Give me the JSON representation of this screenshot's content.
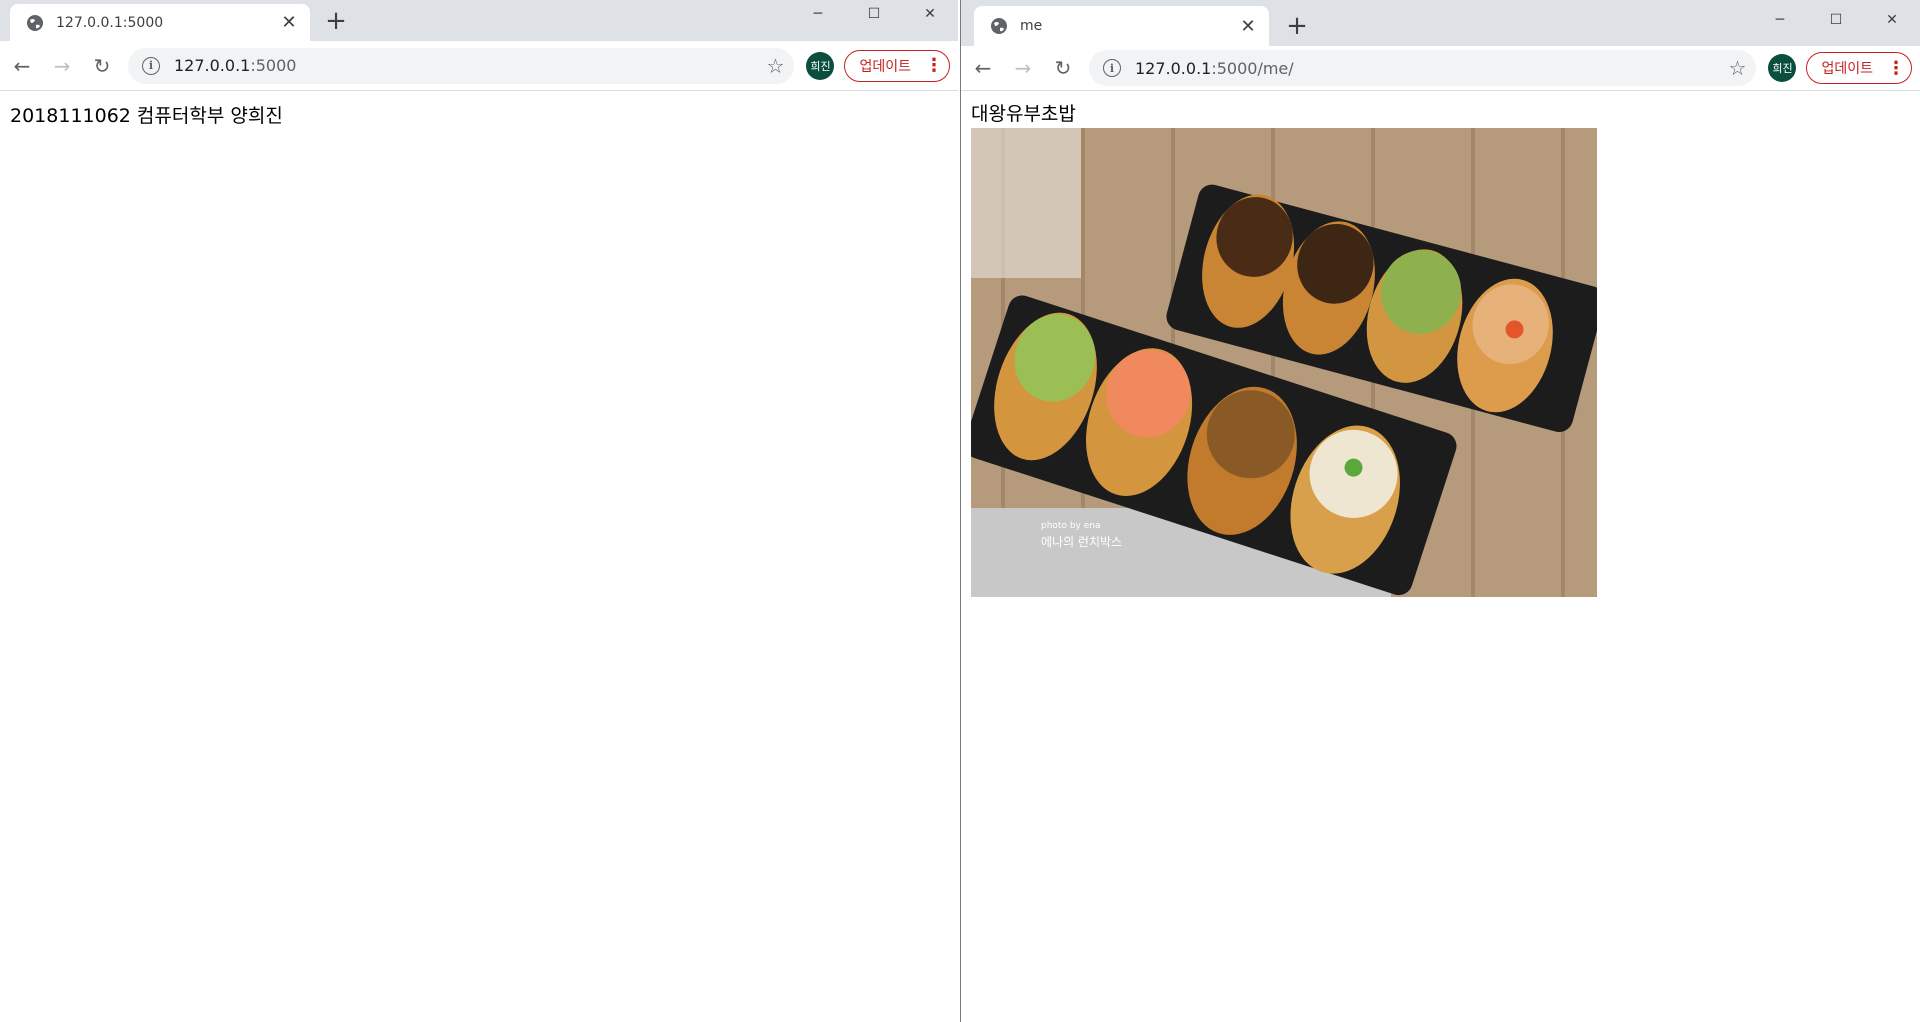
{
  "left_window": {
    "tab_title": "127.0.0.1:5000",
    "url_host": "127.0.0.1",
    "url_path": ":5000",
    "profile_initials": "희진",
    "update_label": "업데이트",
    "body_text": "2018111062 컴퓨터학부 양희진"
  },
  "right_window": {
    "tab_title": "me",
    "url_host": "127.0.0.1",
    "url_path": ":5000/me/",
    "profile_initials": "희진",
    "update_label": "업데이트",
    "heading": "대왕유부초밥",
    "image_watermark_small": "photo by ena",
    "image_watermark": "에나의 런치박스"
  },
  "icons": {
    "favicon": "globe-icon",
    "close": "close-icon",
    "new_tab": "plus-icon",
    "back": "back-arrow-icon",
    "forward": "forward-arrow-icon",
    "reload": "reload-icon",
    "info": "info-icon",
    "bookmark": "star-icon",
    "menu": "kebab-menu-icon"
  },
  "colors": {
    "titlebar": "#dee1e6",
    "avatar_bg": "#0a4f3e",
    "update_accent": "#c5221f",
    "omnibox_bg": "#f1f3f4"
  }
}
